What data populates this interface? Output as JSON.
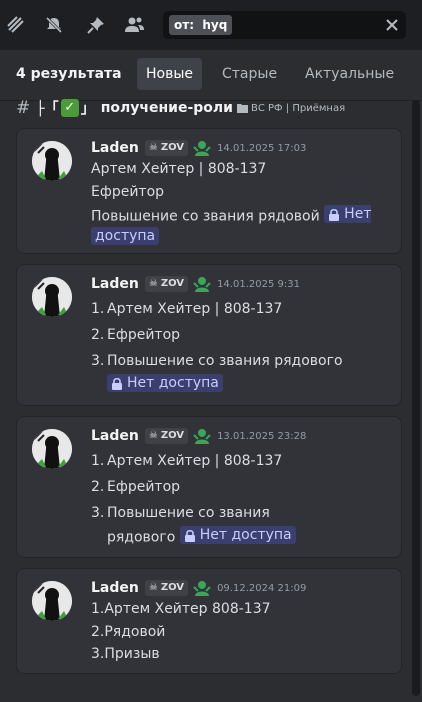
{
  "toolbar": {
    "icons": [
      "threads-icon",
      "mute-icon",
      "pin-icon",
      "members-icon"
    ],
    "search": {
      "chip": "от:",
      "query": "hyq"
    }
  },
  "header": {
    "result_count": "4 результата",
    "tabs": [
      {
        "label": "Новые",
        "active": true
      },
      {
        "label": "Старые",
        "active": false
      },
      {
        "label": "Актуальные",
        "active": false
      }
    ]
  },
  "channel": {
    "prefix": "├「",
    "suffix": "」",
    "name": "получение-роли",
    "category": "ВС РФ | Приёмная"
  },
  "messages": [
    {
      "author": "Laden",
      "tag": "ZOV",
      "timestamp": "14.01.2025 17:03",
      "lines": [
        "Артем Хейтер | 808-137",
        "Ефрейтор",
        "Повышение со звания рядовой"
      ],
      "no_access": "Нет доступа",
      "no_access_wrap": "доступа"
    },
    {
      "author": "Laden",
      "tag": "ZOV",
      "timestamp": "14.01.2025 9:31",
      "items": [
        {
          "num": "1.",
          "text": "Артем Хейтер | 808-137"
        },
        {
          "num": "2.",
          "text": "Ефрейтор"
        },
        {
          "num": "3.",
          "text": "Повышение со звания рядового"
        }
      ],
      "no_access": "Нет доступа"
    },
    {
      "author": "Laden",
      "tag": "ZOV",
      "timestamp": "13.01.2025 23:28",
      "items": [
        {
          "num": "1.",
          "text": "Артем Хейтер | 808-137"
        },
        {
          "num": "2.",
          "text": "Ефрейтор"
        },
        {
          "num": "3.",
          "text": "Повышение со звания"
        }
      ],
      "wrap_text": "рядового",
      "no_access": "Нет доступа"
    },
    {
      "author": "Laden",
      "tag": "ZOV",
      "timestamp": "09.12.2024 21:09",
      "lines": [
        "1.Артем Хейтер 808-137",
        "2.Рядовой",
        "3.Призыв"
      ]
    }
  ],
  "colors": {
    "accent": "#3b3f70",
    "role_green": "#3ba55d",
    "check_green": "#4a9c3b"
  }
}
